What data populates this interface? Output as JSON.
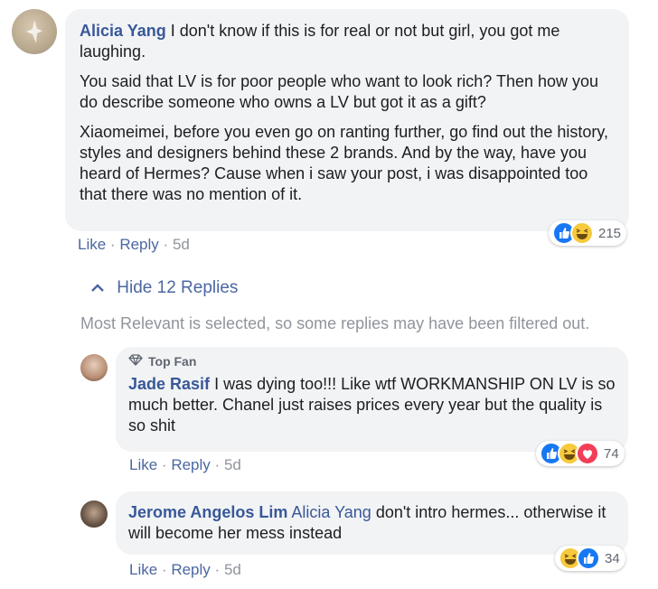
{
  "comment": {
    "author": "Alicia Yang",
    "paragraph1": "I don't know if this is for real or not but girl, you got me laughing.",
    "paragraph2": "You said that LV is for poor people who want to look rich? Then how you do describe someone who owns a LV but got it as a gift?",
    "paragraph3": "Xiaomeimei, before you even go on ranting further, go find out the history, styles and designers behind these 2 brands. And by the way, have you heard of Hermes? Cause when i saw your post, i was disappointed too that there was no mention of it.",
    "reaction_count": "215",
    "like_label": "Like",
    "reply_label": "Reply",
    "time": "5d",
    "separator": "·"
  },
  "hide_replies": {
    "label": "Hide 12 Replies"
  },
  "filter_note": "Most Relevant is selected, so some replies may have been filtered out.",
  "replies": [
    {
      "badge": "Top Fan",
      "author": "Jade Rasif",
      "text": "I was dying too!!! Like wtf WORKMANSHIP ON LV is so much better. Chanel just raises prices every year but the quality is so shit",
      "reaction_count": "74",
      "like_label": "Like",
      "reply_label": "Reply",
      "time": "5d"
    },
    {
      "author": "Jerome Angelos Lim",
      "mention": "Alicia Yang",
      "text": "don't intro hermes... otherwise it will become her mess instead",
      "reaction_count": "34",
      "like_label": "Like",
      "reply_label": "Reply",
      "time": "5d"
    }
  ],
  "icons": [
    "like-reaction-icon",
    "haha-reaction-icon",
    "love-reaction-icon",
    "diamond-icon",
    "chevron-up-icon"
  ],
  "colors": {
    "link": "#385898",
    "action": "#4b67a1",
    "meta": "#90949c",
    "bubble": "#f2f3f5",
    "like": "#1877f2",
    "haha": "#f7c93d",
    "love": "#f33e58"
  }
}
